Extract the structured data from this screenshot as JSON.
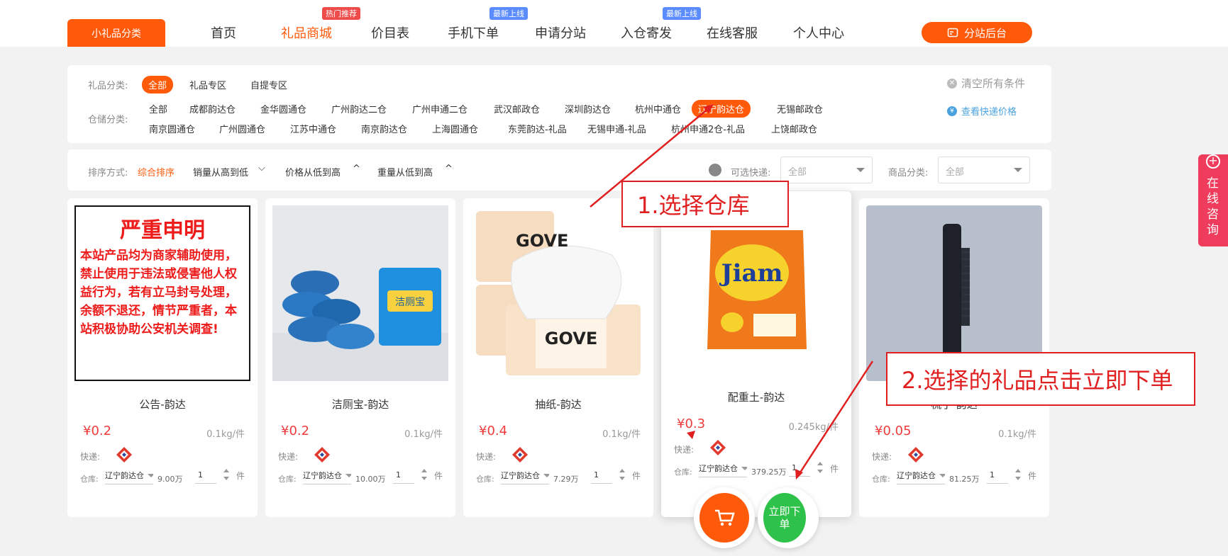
{
  "nav": {
    "category_button": "小礼品分类",
    "items": [
      "首页",
      "礼品商城",
      "价目表",
      "手机下单",
      "申请分站",
      "入仓寄发",
      "在线客服",
      "个人中心"
    ],
    "badges": {
      "hot": "热门推荐",
      "new1": "最新上线",
      "new2": "最新上线"
    },
    "admin_button": "分站后台"
  },
  "filters": {
    "category_label": "礼品分类:",
    "categories": [
      "全部",
      "礼品专区",
      "自提专区"
    ],
    "warehouse_label": "仓储分类:",
    "warehouses_row1": [
      "全部",
      "成都韵达仓",
      "金华圆通仓",
      "广州韵达二仓",
      "广州申通二仓",
      "武汉邮政仓",
      "深圳韵达仓",
      "杭州中通仓",
      "辽宁韵达仓",
      "无锡邮政仓"
    ],
    "warehouses_row2": [
      "南京圆通仓",
      "广州圆通仓",
      "江苏中通仓",
      "南京韵达仓",
      "上海圆通仓",
      "东莞韵达-礼品",
      "无锡申通-礼品",
      "杭州申通2仓-礼品",
      "上饶邮政仓"
    ],
    "clear_all": "清空所有条件",
    "express_price": "查看快递价格"
  },
  "sortbar": {
    "label": "排序方式:",
    "options": [
      "综合排序",
      "销量从高到低",
      "价格从低到高",
      "重量从低到高"
    ],
    "express_label": "可选快递:",
    "express_value": "全部",
    "product_cat_label": "商品分类:",
    "product_cat_value": "全部"
  },
  "notice": {
    "title": "严重申明",
    "body": "本站产品均为商家辅助使用，禁止使用于违法或侵害他人权益行为，若有立马封号处理，余额不退还，情节严重者，本站积极协助公安机关调查!"
  },
  "labels": {
    "express": "快递:",
    "warehouse": "仓库:",
    "unit": "件"
  },
  "products": [
    {
      "name": "公告-韵达",
      "price": "¥0.2",
      "weight": "0.1kg/件",
      "warehouse": "辽宁韵达仓",
      "stock": "9.00万",
      "qty": "1"
    },
    {
      "name": "洁厕宝-韵达",
      "price": "¥0.2",
      "weight": "0.1kg/件",
      "warehouse": "辽宁韵达仓",
      "stock": "10.00万",
      "qty": "1"
    },
    {
      "name": "抽纸-韵达",
      "price": "¥0.4",
      "weight": "0.1kg/件",
      "warehouse": "辽宁韵达仓",
      "stock": "7.29万",
      "qty": "1"
    },
    {
      "name": "配重土-韵达",
      "price": "¥0.3",
      "weight": "0.245kg/件",
      "warehouse": "辽宁韵达仓",
      "stock": "379.25万",
      "qty": "1"
    },
    {
      "name": "梳子-韵达",
      "price": "¥0.05",
      "weight": "0.1kg/件",
      "warehouse": "辽宁韵达仓",
      "stock": "81.25万",
      "qty": "1"
    }
  ],
  "annotations": {
    "step1": "1.选择仓库",
    "step2": "2.选择的礼品点击立即下单"
  },
  "actions": {
    "buy_now": "立即下单"
  },
  "consult": "在线咨询",
  "tissue_brand": "GOVE",
  "detergent_brand": "Jiam"
}
